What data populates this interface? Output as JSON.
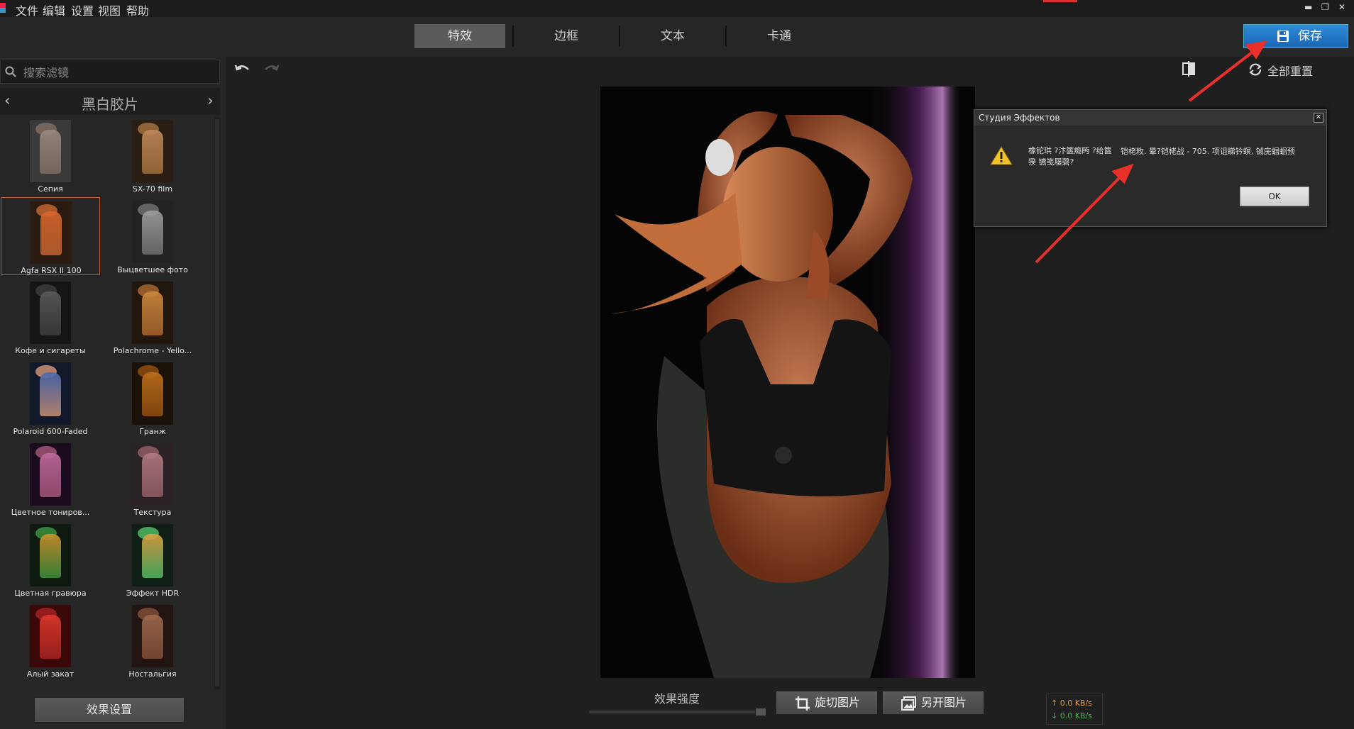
{
  "menu": [
    "文件",
    "编辑",
    "设置",
    "视图",
    "帮助"
  ],
  "tabs": [
    {
      "label": "特效",
      "active": true
    },
    {
      "label": "边框",
      "active": false
    },
    {
      "label": "文本",
      "active": false
    },
    {
      "label": "卡通",
      "active": false
    }
  ],
  "save_label": "保存",
  "search": {
    "placeholder": "搜索滤镜"
  },
  "category": {
    "title": "黑白胶片",
    "prev": "‹",
    "next": "›"
  },
  "filters": [
    {
      "label": "Сепия"
    },
    {
      "label": "SX-70 film"
    },
    {
      "label": "Agfa RSX II 100",
      "selected": true
    },
    {
      "label": "Выцветшее фото"
    },
    {
      "label": "Кофе и сигареты"
    },
    {
      "label": "Polachrome - Yello..."
    },
    {
      "label": "Polaroid 600-Faded"
    },
    {
      "label": "Гранж"
    },
    {
      "label": "Цветное тониров..."
    },
    {
      "label": "Текстура"
    },
    {
      "label": "Цветная гравюра"
    },
    {
      "label": "Эффект HDR"
    },
    {
      "label": "Алый закат"
    },
    {
      "label": "Ностальгия"
    }
  ],
  "effect_settings_label": "效果设置",
  "reset_all_label": "全部重置",
  "strength_label": "效果强度",
  "crop_label": "旋切图片",
  "open_label": "另开图片",
  "net_rate": {
    "up": "↑ 0.0 KB/s",
    "down": "↓ 0.0 KB/s"
  },
  "dialog": {
    "title": "Студия Эффектов",
    "message_left": "橡铊珙 ?汴篋瘾眄 ?给篋猤 镳笺屦磬?",
    "message_right": "铠栳敉. 晕?铠栳战 - 705. 项诅睇钤螟, 铖庑蝈蛔预",
    "ok_label": "OK"
  },
  "colors": {
    "accent": "#1f74c4",
    "selected_border": "#c55a2a",
    "arrow": "#e8302a"
  }
}
